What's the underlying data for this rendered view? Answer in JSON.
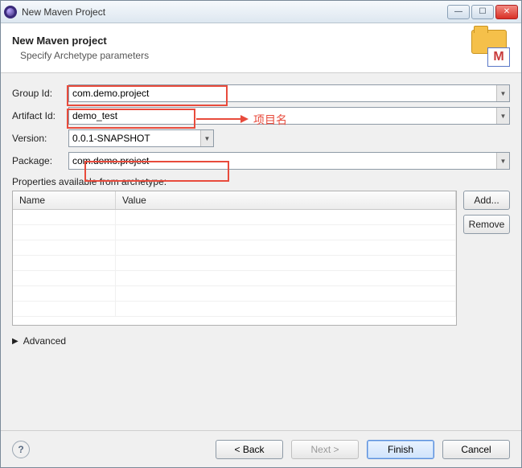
{
  "window": {
    "title": "New Maven Project"
  },
  "header": {
    "title": "New Maven project",
    "subtitle": "Specify Archetype parameters",
    "iconLetter": "M"
  },
  "form": {
    "groupId": {
      "label": "Group Id:",
      "value": "com.demo.project"
    },
    "artifactId": {
      "label": "Artifact Id:",
      "value": "demo_test"
    },
    "version": {
      "label": "Version:",
      "value": "0.0.1-SNAPSHOT"
    },
    "package": {
      "label": "Package:",
      "value": "com.demo.project"
    }
  },
  "annotation": {
    "text": "项目名"
  },
  "properties": {
    "label": "Properties available from archetype:",
    "columns": {
      "name": "Name",
      "value": "Value"
    },
    "buttons": {
      "add": "Add...",
      "remove": "Remove"
    }
  },
  "advanced": {
    "label": "Advanced"
  },
  "footer": {
    "back": "< Back",
    "next": "Next >",
    "finish": "Finish",
    "cancel": "Cancel"
  }
}
